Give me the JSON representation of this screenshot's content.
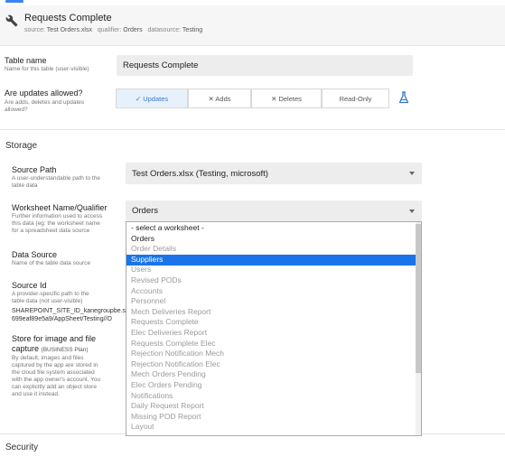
{
  "header": {
    "title": "Requests Complete",
    "source_key": "source:",
    "source_val": "Test Orders.xlsx",
    "qualifier_key": "qualifier:",
    "qualifier_val": "Orders",
    "datasource_key": "datasource:",
    "datasource_val": "Testing",
    "icon": "wrench-icon"
  },
  "table_name": {
    "label": "Table name",
    "desc": "Name for this table (user-visible)",
    "value": "Requests Complete"
  },
  "updates": {
    "label": "Are updates allowed?",
    "desc1": "Are adds, deletes and updates",
    "desc2": "allowed?",
    "options": [
      "✓ Updates",
      "✕ Adds",
      "✕ Deletes",
      "Read-Only"
    ],
    "selected": "Updates",
    "icon": "flask-icon"
  },
  "storage": {
    "title": "Storage",
    "source_path": {
      "label": "Source Path",
      "desc1": "A user-understandable path to the",
      "desc2": "table data",
      "value": "Test Orders.xlsx (Testing, microsoft)"
    },
    "worksheet": {
      "label": "Worksheet Name/Qualifier",
      "desc1": "Further information used to access",
      "desc2": "this data (eg: the worksheet name",
      "desc3": "for a spreadsheet data source",
      "value": "Orders"
    },
    "data_source": {
      "label": "Data Source",
      "desc": "Name of the table data source"
    },
    "source_id": {
      "label": "Source Id",
      "desc1": "A provider-specific path to the",
      "desc2": "table data (not user-visible)",
      "value1": "SHAREPOINT_SITE_ID_kanegroupbe.s",
      "value2": "699eaf89e5a9/AppSheet/Testing//O"
    },
    "image_store": {
      "label1": "Store for image and file",
      "label2": "capture",
      "plan": "(BUSINESS Plan)",
      "desc1": "By default, images and files",
      "desc2": "captured by the app are stored in",
      "desc3": "the cloud file system associated",
      "desc4": "with the app owner's account. You",
      "desc5": "can explicitly add an object store",
      "desc6": "and use it instead."
    }
  },
  "dropdown": {
    "items": [
      {
        "label": "- select a worksheet -",
        "state": "enabled"
      },
      {
        "label": "Orders",
        "state": "enabled"
      },
      {
        "label": "Order Details",
        "state": "disabled"
      },
      {
        "label": "Suppliers",
        "state": "selected"
      },
      {
        "label": "Users",
        "state": "disabled"
      },
      {
        "label": "Revised PODs",
        "state": "disabled"
      },
      {
        "label": "Accounts",
        "state": "disabled"
      },
      {
        "label": "Personnel",
        "state": "disabled"
      },
      {
        "label": "Mech Deliveries Report",
        "state": "disabled"
      },
      {
        "label": "Requests Complete",
        "state": "disabled"
      },
      {
        "label": "Elec Deliveries Report",
        "state": "disabled"
      },
      {
        "label": "Requests Complete Elec",
        "state": "disabled"
      },
      {
        "label": "Rejection Notification Mech",
        "state": "disabled"
      },
      {
        "label": "Rejection Notification Elec",
        "state": "disabled"
      },
      {
        "label": "Mech Orders Pending",
        "state": "disabled"
      },
      {
        "label": "Elec Orders Pending",
        "state": "disabled"
      },
      {
        "label": "Notifications",
        "state": "disabled"
      },
      {
        "label": "Daily Request Report",
        "state": "disabled"
      },
      {
        "label": "Missing POD Report",
        "state": "disabled"
      },
      {
        "label": "Layout",
        "state": "disabled"
      }
    ]
  },
  "security": {
    "title": "Security"
  }
}
